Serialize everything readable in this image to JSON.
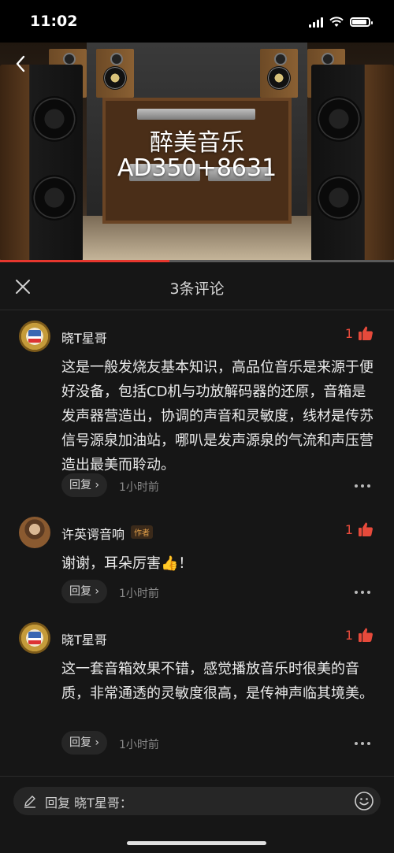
{
  "status_bar": {
    "time": "11:02"
  },
  "video": {
    "title_line1": "醉美音乐",
    "title_line2": "AD350+8631",
    "progress_fraction": 0.43
  },
  "comments_sheet": {
    "title": "3条评论",
    "comments": [
      {
        "username": "晓T星哥",
        "author_tag": "",
        "likes": "1",
        "text": "这是一般发烧友基本知识，高品位音乐是来源于便好没备，包括CD机与功放解码器的还原，音箱是发声器营造出，协调的声音和灵敏度，线材是传苏信号源泉加油站，哪叭是发声源泉的气流和声压营造出最美而聆动。",
        "reply_label": "回复 ›",
        "time": "1小时前"
      },
      {
        "username": "许英谔音响",
        "author_tag": "作者",
        "likes": "1",
        "text": "谢谢，耳朵厉害👍！",
        "reply_label": "回复 ›",
        "time": "1小时前"
      },
      {
        "username": "晓T星哥",
        "author_tag": "",
        "likes": "1",
        "text": "这一套音箱效果不错，感觉播放音乐时很美的音质，非常通透的灵敏度很高，是传神声临其境美。",
        "reply_label": "回复 ›",
        "time": "1小时前"
      }
    ]
  },
  "reply_input": {
    "placeholder": "回复 晓T星哥："
  },
  "colors": {
    "accent": "#e64a3b",
    "progress": "#e6372e",
    "background": "#161616",
    "author_tag": "#e3a04a"
  },
  "icons": [
    "back-arrow-icon",
    "close-icon",
    "thumbs-up-icon",
    "more-dots-icon",
    "pencil-icon",
    "emoji-icon",
    "wifi-icon",
    "signal-icon",
    "battery-icon"
  ]
}
